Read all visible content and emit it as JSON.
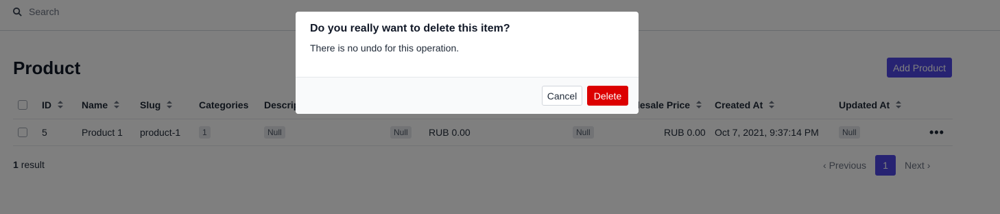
{
  "search": {
    "placeholder": "Search",
    "icon": "search-icon"
  },
  "page": {
    "title": "Product",
    "add_button": "Add Product"
  },
  "table": {
    "headers": [
      {
        "label": "ID",
        "sortable": true
      },
      {
        "label": "Name",
        "sortable": true
      },
      {
        "label": "Slug",
        "sortable": true
      },
      {
        "label": "Categories",
        "sortable": false
      },
      {
        "label": "Descrip",
        "sortable": false
      },
      {
        "label": "lesale Price",
        "sortable": true
      },
      {
        "label": "Created At",
        "sortable": true
      },
      {
        "label": "Updated At",
        "sortable": true
      }
    ],
    "rows": [
      {
        "id": "5",
        "name": "Product 1",
        "slug": "product-1",
        "categories": "1",
        "description": "Null",
        "col6": "Null",
        "price": "RUB 0.00",
        "col8": "Null",
        "wholesale_price": "RUB 0.00",
        "created_at": "Oct 7, 2021, 9:37:14 PM",
        "updated_at": "Null",
        "actions": "•••"
      }
    ]
  },
  "footer": {
    "count": "1",
    "count_label": "result",
    "previous": "Previous",
    "current_page": "1",
    "next": "Next"
  },
  "modal": {
    "title": "Do you really want to delete this item?",
    "message": "There is no undo for this operation.",
    "cancel": "Cancel",
    "delete": "Delete"
  },
  "colors": {
    "accent": "#4f46e5",
    "danger": "#dc0000",
    "overlay": "rgba(0,0,0,0.5)"
  }
}
